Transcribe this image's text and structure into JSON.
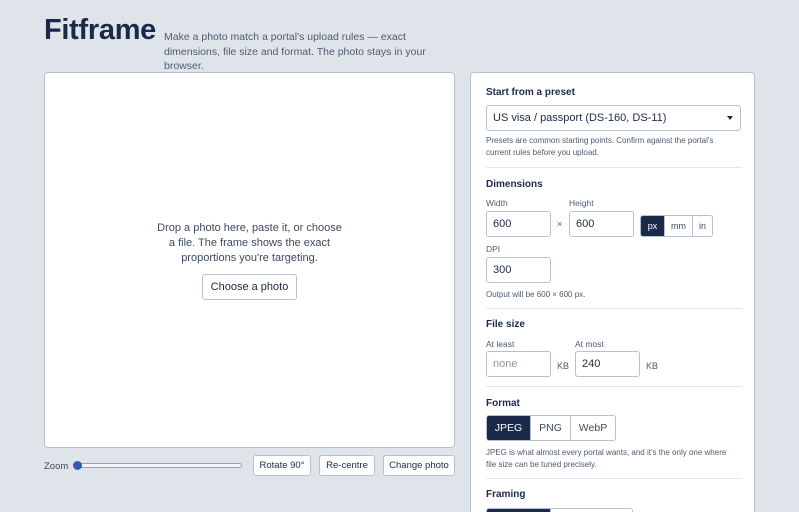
{
  "app": {
    "title": "Fitframe",
    "tagline": "Make a photo match a portal's upload rules — exact dimensions, file size and format. The photo stays in your browser."
  },
  "stage": {
    "prompt": "Drop a photo here, paste it, or choose a file. The frame shows the exact proportions you're targeting.",
    "choose_label": "Choose a photo"
  },
  "controls": {
    "zoom_label": "Zoom",
    "zoom_value": 0,
    "rotate_label": "Rotate 90°",
    "recentre_label": "Re-centre",
    "change_label": "Change photo"
  },
  "preset": {
    "title": "Start from a preset",
    "selected": "US visa / passport (DS-160, DS-11)",
    "help": "Presets are common starting points. Confirm against the portal's current rules before you upload."
  },
  "dimensions": {
    "title": "Dimensions",
    "width_label": "Width",
    "width_value": "600",
    "times": "×",
    "height_label": "Height",
    "height_value": "600",
    "units": [
      "px",
      "mm",
      "in"
    ],
    "active_unit": "px",
    "dpi_label": "DPI",
    "dpi_value": "300",
    "output_text": "Output will be 600 × 600 px."
  },
  "filesize": {
    "title": "File size",
    "min_label": "At least",
    "min_placeholder": "none",
    "min_unit": "KB",
    "max_label": "At most",
    "max_value": "240",
    "max_unit": "KB"
  },
  "format": {
    "title": "Format",
    "options": [
      "JPEG",
      "PNG",
      "WebP"
    ],
    "active": "JPEG",
    "help": "JPEG is what almost every portal wants, and it's the only one where file size can be tuned precisely."
  },
  "framing": {
    "title": "Framing"
  },
  "colors": {
    "accent": "#1b2a4a",
    "slider_thumb": "#2f5bb5",
    "background": "#dfe4eb"
  }
}
